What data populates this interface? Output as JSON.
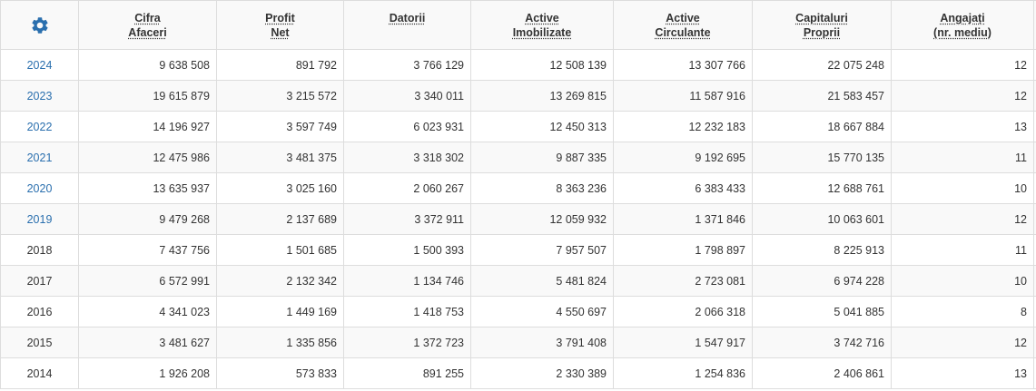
{
  "table": {
    "columns": [
      {
        "line1": "Cifra",
        "line2": "Afaceri"
      },
      {
        "line1": "Profit",
        "line2": "Net"
      },
      {
        "line1": "Datorii",
        "line2": ""
      },
      {
        "line1": "Active",
        "line2": "Imobilizate"
      },
      {
        "line1": "Active",
        "line2": "Circulante"
      },
      {
        "line1": "Capitaluri",
        "line2": "Proprii"
      },
      {
        "line1": "Angajați",
        "line2": "(nr. mediu)"
      }
    ],
    "settings_icon": "gear-icon",
    "link_color": "#2a6fae",
    "rows": [
      {
        "year": "2024",
        "linked": true,
        "values": [
          "9 638 508",
          "891 792",
          "3 766 129",
          "12 508 139",
          "13 307 766",
          "22 075 248",
          "12"
        ]
      },
      {
        "year": "2023",
        "linked": true,
        "values": [
          "19 615 879",
          "3 215 572",
          "3 340 011",
          "13 269 815",
          "11 587 916",
          "21 583 457",
          "12"
        ]
      },
      {
        "year": "2022",
        "linked": true,
        "values": [
          "14 196 927",
          "3 597 749",
          "6 023 931",
          "12 450 313",
          "12 232 183",
          "18 667 884",
          "13"
        ]
      },
      {
        "year": "2021",
        "linked": true,
        "values": [
          "12 475 986",
          "3 481 375",
          "3 318 302",
          "9 887 335",
          "9 192 695",
          "15 770 135",
          "11"
        ]
      },
      {
        "year": "2020",
        "linked": true,
        "values": [
          "13 635 937",
          "3 025 160",
          "2 060 267",
          "8 363 236",
          "6 383 433",
          "12 688 761",
          "10"
        ]
      },
      {
        "year": "2019",
        "linked": true,
        "values": [
          "9 479 268",
          "2 137 689",
          "3 372 911",
          "12 059 932",
          "1 371 846",
          "10 063 601",
          "12"
        ]
      },
      {
        "year": "2018",
        "linked": false,
        "values": [
          "7 437 756",
          "1 501 685",
          "1 500 393",
          "7 957 507",
          "1 798 897",
          "8 225 913",
          "11"
        ]
      },
      {
        "year": "2017",
        "linked": false,
        "values": [
          "6 572 991",
          "2 132 342",
          "1 134 746",
          "5 481 824",
          "2 723 081",
          "6 974 228",
          "10"
        ]
      },
      {
        "year": "2016",
        "linked": false,
        "values": [
          "4 341 023",
          "1 449 169",
          "1 418 753",
          "4 550 697",
          "2 066 318",
          "5 041 885",
          "8"
        ]
      },
      {
        "year": "2015",
        "linked": false,
        "values": [
          "3 481 627",
          "1 335 856",
          "1 372 723",
          "3 791 408",
          "1 547 917",
          "3 742 716",
          "12"
        ]
      },
      {
        "year": "2014",
        "linked": false,
        "values": [
          "1 926 208",
          "573 833",
          "891 255",
          "2 330 389",
          "1 254 836",
          "2 406 861",
          "13"
        ]
      }
    ]
  }
}
